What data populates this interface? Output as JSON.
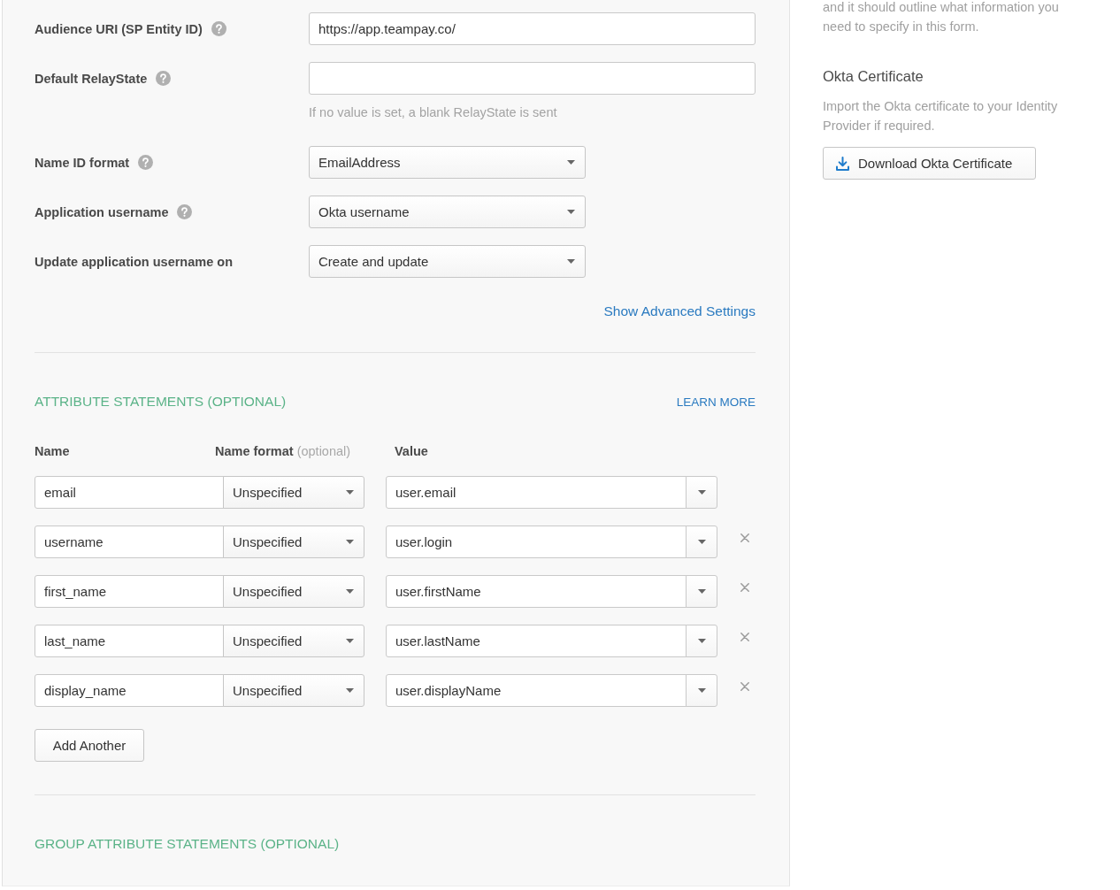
{
  "sign_on": {
    "fields": [
      {
        "kind": "text",
        "label": "Audience URI (SP Entity ID)",
        "help": true,
        "value": "https://app.teampay.co/"
      },
      {
        "kind": "text",
        "label": "Default RelayState",
        "help": true,
        "hint": "If no value is set, a blank RelayState is sent"
      },
      {
        "kind": "select",
        "label": "Name ID format",
        "help": true,
        "value": "EmailAddress"
      },
      {
        "kind": "select",
        "label": "Application username",
        "help": true,
        "value": "Okta username"
      },
      {
        "kind": "select",
        "label": "Update application username on",
        "help": false,
        "value": "Create and update"
      }
    ],
    "advanced_link": "Show Advanced Settings"
  },
  "attribute_statements": {
    "title": "ATTRIBUTE STATEMENTS (OPTIONAL)",
    "learn_more": "LEARN MORE",
    "columns": [
      {
        "label": "Name"
      },
      {
        "label": "Name format",
        "note": "(optional)"
      },
      {
        "label": "Value"
      }
    ],
    "rows": [
      {
        "name": "email",
        "name_format": "Unspecified",
        "value": "user.email",
        "removable": false
      },
      {
        "name": "username",
        "name_format": "Unspecified",
        "value": "user.login",
        "removable": true
      },
      {
        "name": "first_name",
        "name_format": "Unspecified",
        "value": "user.firstName",
        "removable": true
      },
      {
        "name": "last_name",
        "name_format": "Unspecified",
        "value": "user.lastName",
        "removable": true
      },
      {
        "name": "display_name",
        "name_format": "Unspecified",
        "value": "user.displayName",
        "removable": true
      }
    ],
    "add_button": "Add Another"
  },
  "group_attribute_statements": {
    "title": "GROUP ATTRIBUTE STATEMENTS (OPTIONAL)"
  },
  "sidebar": {
    "intro": "and it should outline what information you need to specify in this form.",
    "certificate": {
      "title": "Okta Certificate",
      "description": "Import the Okta certificate to your Identity Provider if required.",
      "button": "Download Okta Certificate"
    }
  }
}
